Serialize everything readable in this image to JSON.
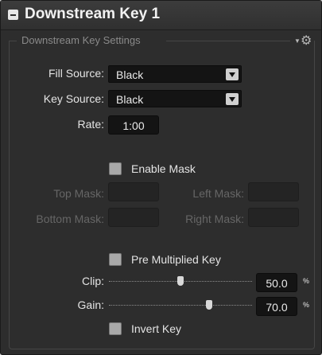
{
  "panel": {
    "title": "Downstream Key 1"
  },
  "settings": {
    "group_title": "Downstream Key Settings",
    "fill_source": {
      "label": "Fill Source:",
      "value": "Black"
    },
    "key_source": {
      "label": "Key Source:",
      "value": "Black"
    },
    "rate": {
      "label": "Rate:",
      "value": "1:00"
    },
    "enable_mask": {
      "label": "Enable Mask",
      "checked": false
    },
    "mask": {
      "top_label": "Top Mask:",
      "top_value": "",
      "left_label": "Left Mask:",
      "left_value": "",
      "bottom_label": "Bottom Mask:",
      "bottom_value": "",
      "right_label": "Right Mask:",
      "right_value": ""
    },
    "pre_multiplied": {
      "label": "Pre Multiplied Key",
      "checked": false
    },
    "clip": {
      "label": "Clip:",
      "value": "50.0",
      "unit": "%",
      "level": 0.5
    },
    "gain": {
      "label": "Gain:",
      "value": "70.0",
      "unit": "%",
      "level": 0.7
    },
    "invert_key": {
      "label": "Invert Key",
      "checked": false
    }
  },
  "colors": {
    "panel_bg": "#2d2d2d",
    "field_bg": "#141414",
    "text": "#e4e4e4",
    "dim_text": "#666666"
  },
  "icons": {
    "collapse": "minus-square-icon",
    "settings": "gear-icon",
    "dropdown": "triangle-down-icon"
  }
}
